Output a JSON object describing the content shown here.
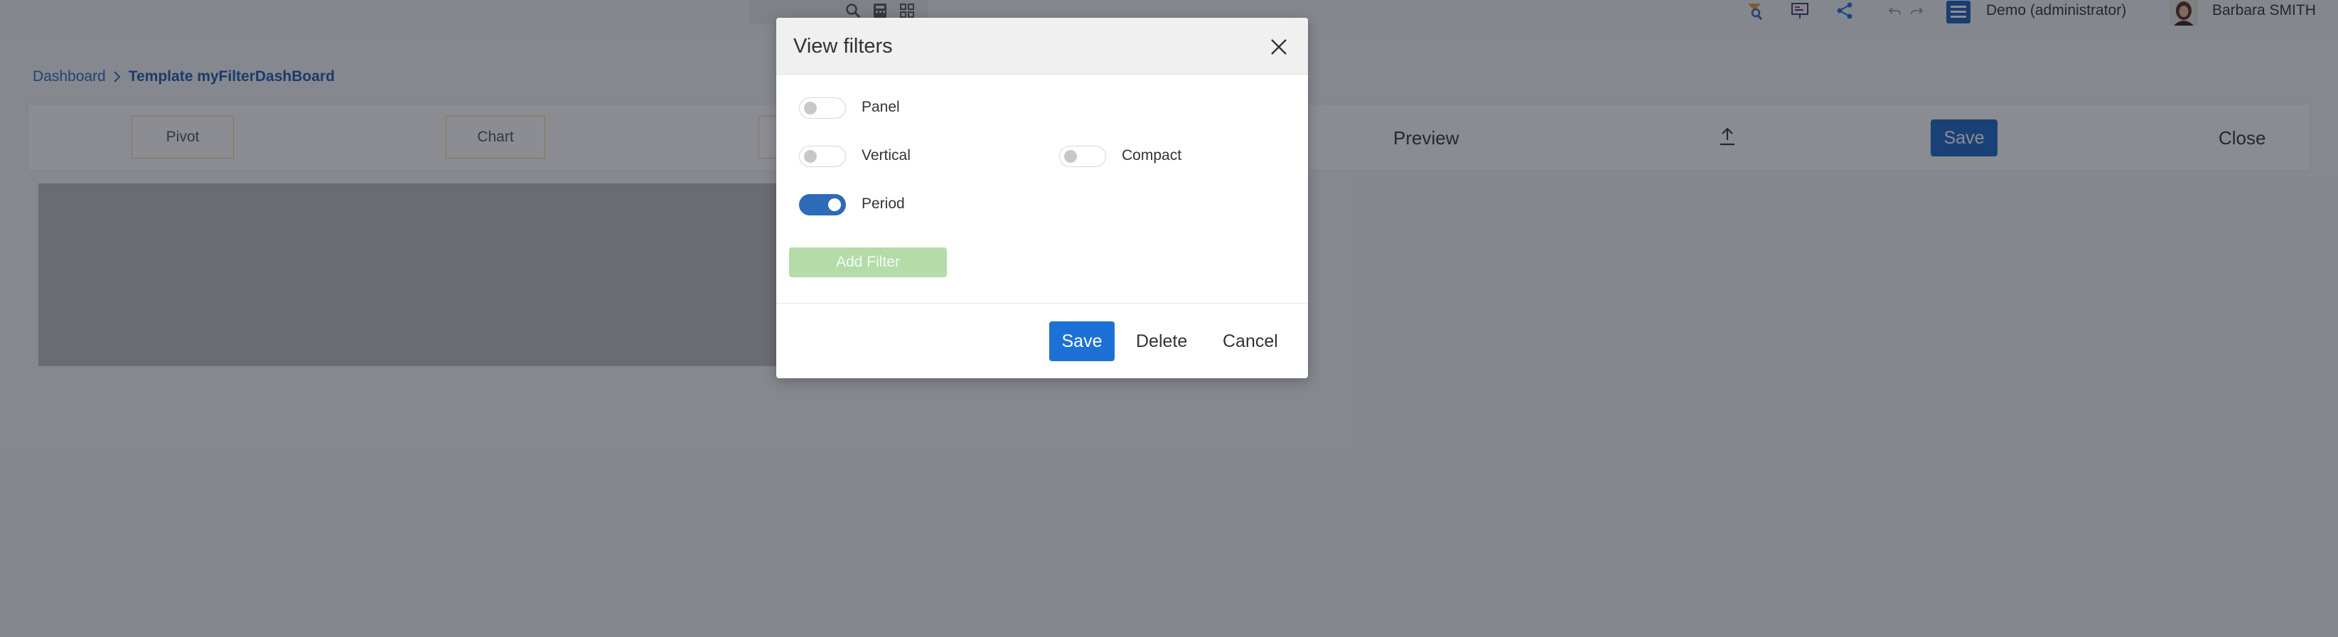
{
  "header": {
    "tool_icons": [
      "search-icon",
      "calculator-icon",
      "grid-icon"
    ],
    "right_icons": [
      "map-pin-icon",
      "presentation-icon",
      "share-icon",
      "undo-icon",
      "redo-icon"
    ],
    "company_label": "Demo (administrator)",
    "user_name": "Barbara SMITH"
  },
  "breadcrumb": {
    "root": "Dashboard",
    "current": "Template myFilterDashBoard"
  },
  "toolbar": {
    "pivot_label": "Pivot",
    "chart_label": "Chart",
    "preview_label": "Preview",
    "save_label": "Save",
    "close_label": "Close"
  },
  "modal": {
    "title": "View filters",
    "toggles": {
      "panel": {
        "label": "Panel",
        "on": false
      },
      "vertical": {
        "label": "Vertical",
        "on": false
      },
      "compact": {
        "label": "Compact",
        "on": false
      },
      "period": {
        "label": "Period",
        "on": true
      }
    },
    "add_filter_label": "Add Filter",
    "save_label": "Save",
    "delete_label": "Delete",
    "cancel_label": "Cancel"
  },
  "colors": {
    "primary": "#1d70d6",
    "toggle_on": "#2d6bb8",
    "add_filter_bg": "#b4dba8",
    "breadcrumb_link": "#2a6ab8",
    "overlay": "rgba(23,27,40,0.5)"
  }
}
